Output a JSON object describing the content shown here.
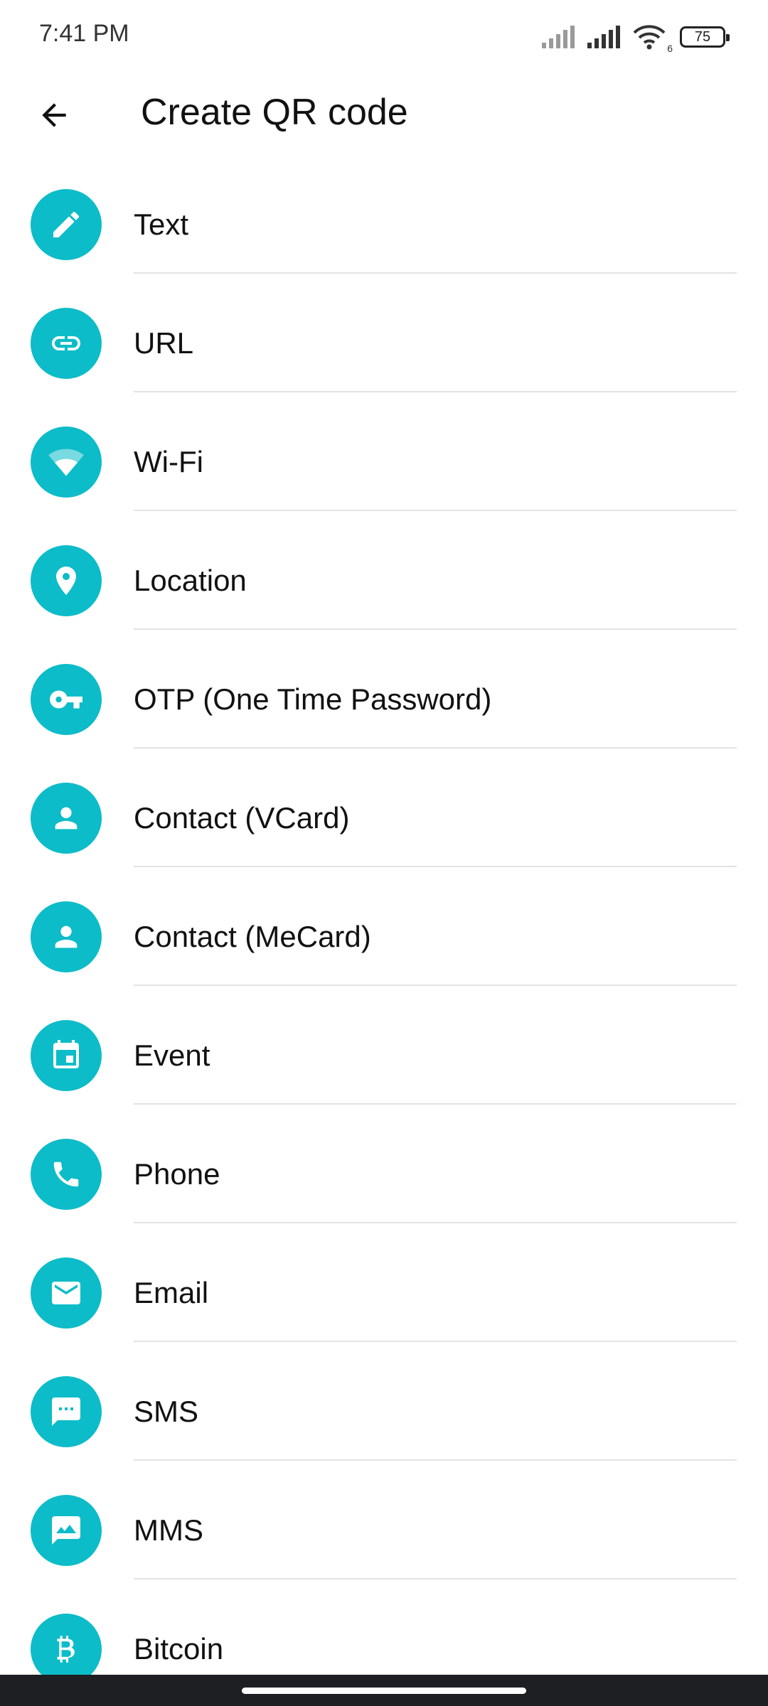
{
  "status": {
    "time": "7:41 PM",
    "battery": "75",
    "wifi_suffix": "6"
  },
  "app_bar": {
    "title": "Create QR code"
  },
  "items": [
    {
      "label": "Text",
      "icon": "pencil-icon"
    },
    {
      "label": "URL",
      "icon": "link-icon"
    },
    {
      "label": "Wi-Fi",
      "icon": "wifi-icon"
    },
    {
      "label": "Location",
      "icon": "location-pin-icon"
    },
    {
      "label": "OTP (One Time Password)",
      "icon": "key-icon"
    },
    {
      "label": "Contact (VCard)",
      "icon": "person-icon"
    },
    {
      "label": "Contact (MeCard)",
      "icon": "person-icon"
    },
    {
      "label": "Event",
      "icon": "calendar-icon"
    },
    {
      "label": "Phone",
      "icon": "phone-icon"
    },
    {
      "label": "Email",
      "icon": "email-icon"
    },
    {
      "label": "SMS",
      "icon": "sms-icon"
    },
    {
      "label": "MMS",
      "icon": "mms-icon"
    },
    {
      "label": "Bitcoin",
      "icon": "bitcoin-icon"
    }
  ],
  "colors": {
    "accent": "#0cbcc8",
    "divider": "#e3e3e3",
    "text": "#111111"
  }
}
